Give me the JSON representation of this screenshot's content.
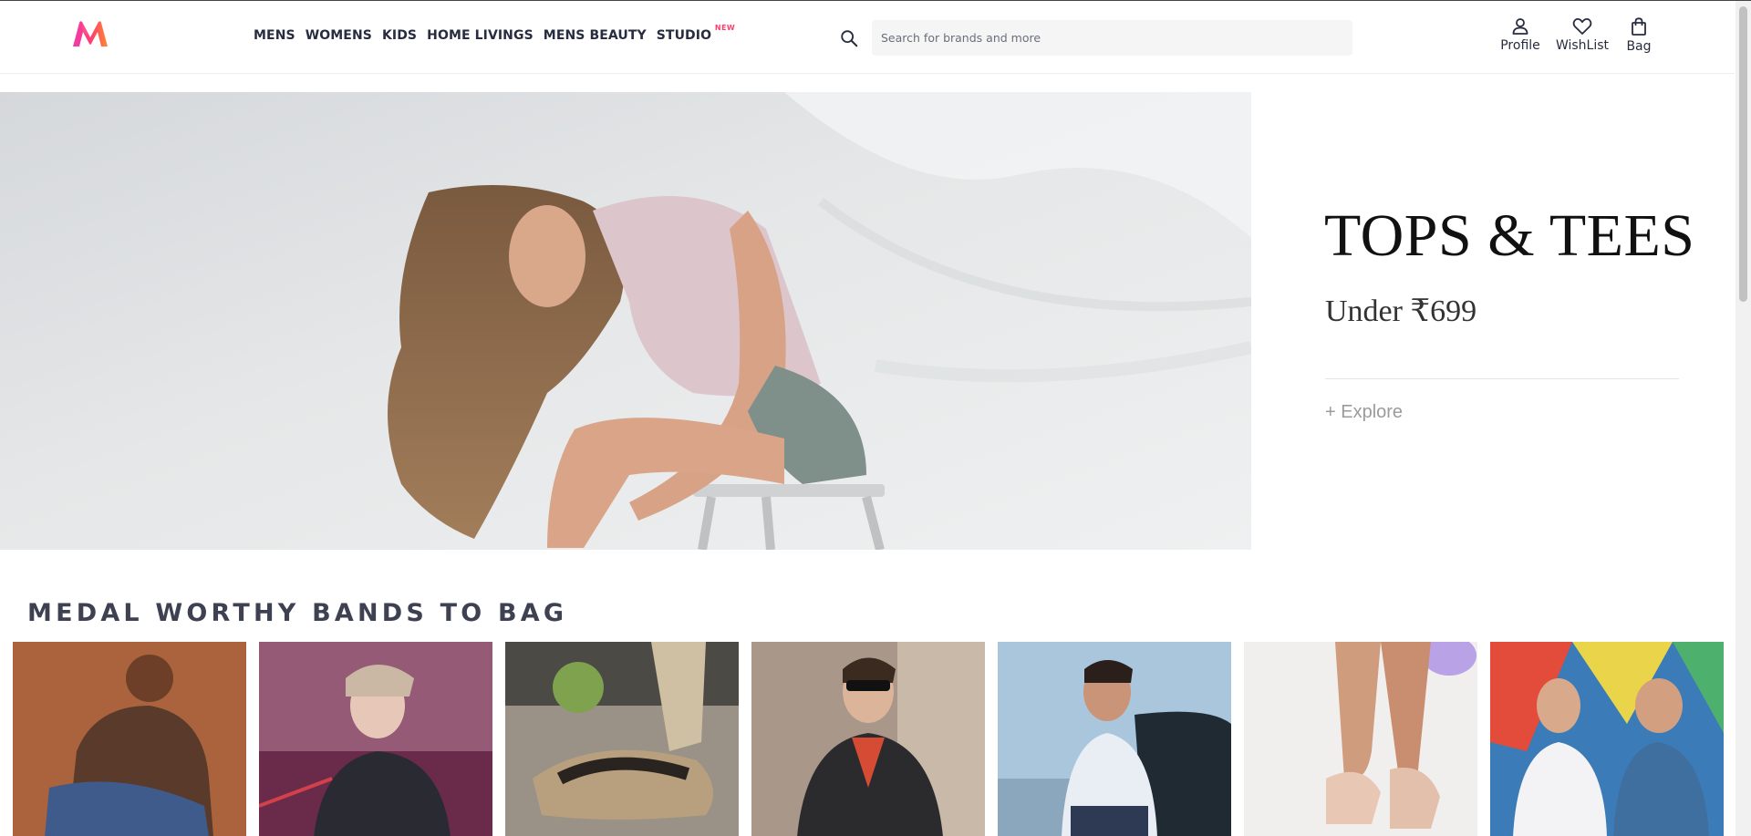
{
  "brand_colors": {
    "accent": "#ff3f6c",
    "text": "#282c3f",
    "muted": "#696e79"
  },
  "header": {
    "logo": "myntra-logo",
    "nav": [
      {
        "label": "MENS"
      },
      {
        "label": "WOMENS"
      },
      {
        "label": "KIDS"
      },
      {
        "label": "HOME LIVINGS"
      },
      {
        "label": "MENS BEAUTY"
      },
      {
        "label": "STUDIO",
        "badge": "NEW"
      }
    ],
    "search": {
      "icon": "search-icon",
      "placeholder": "Search for brands and more",
      "value": ""
    },
    "actions": [
      {
        "label": "Profile",
        "icon": "profile-icon"
      },
      {
        "label": "WishList",
        "icon": "heart-icon"
      },
      {
        "label": "Bag",
        "icon": "bag-icon"
      }
    ]
  },
  "banner": {
    "title": "TOPS & TEES",
    "subtitle": "Under ₹699",
    "cta": "+ Explore"
  },
  "section": {
    "title": "MEDAL WORTHY BANDS TO BAG",
    "cards": [
      {
        "name": "brand-card-1"
      },
      {
        "name": "brand-card-2"
      },
      {
        "name": "brand-card-3"
      },
      {
        "name": "brand-card-4"
      },
      {
        "name": "brand-card-5"
      },
      {
        "name": "brand-card-6"
      },
      {
        "name": "brand-card-7"
      }
    ]
  }
}
